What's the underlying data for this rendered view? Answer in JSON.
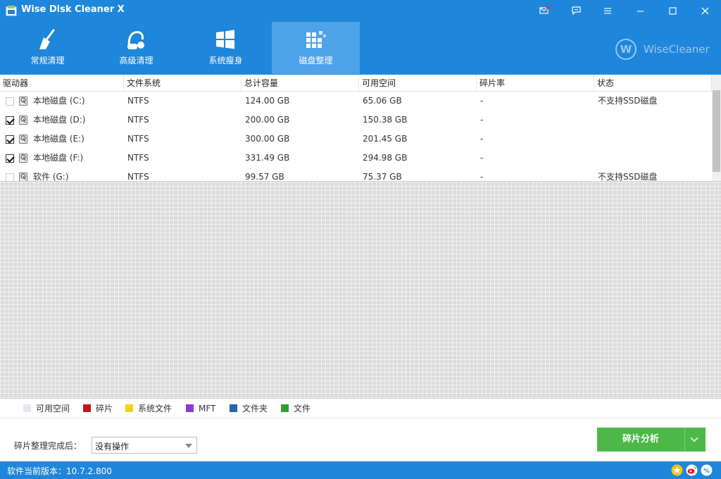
{
  "window": {
    "title": "Wise Disk Cleaner X"
  },
  "tabs": [
    {
      "label": "常规清理",
      "icon": "broom-icon",
      "active": false
    },
    {
      "label": "高级清理",
      "icon": "vacuum-icon",
      "active": false
    },
    {
      "label": "系统瘦身",
      "icon": "windows-icon",
      "active": false
    },
    {
      "label": "磁盘整理",
      "icon": "defrag-blocks-icon",
      "active": true
    }
  ],
  "brand": {
    "logo_letter": "W",
    "name": "WiseCleaner"
  },
  "table": {
    "columns": [
      "驱动器",
      "文件系统",
      "总计容量",
      "可用空间",
      "碎片率",
      "状态"
    ],
    "rows": [
      {
        "checked": false,
        "drive": "本地磁盘 (C:)",
        "fs": "NTFS",
        "total": "124.00 GB",
        "free": "65.06 GB",
        "frag": "-",
        "status": "不支持SSD磁盘"
      },
      {
        "checked": true,
        "drive": "本地磁盘 (D:)",
        "fs": "NTFS",
        "total": "200.00 GB",
        "free": "150.38 GB",
        "frag": "-",
        "status": ""
      },
      {
        "checked": true,
        "drive": "本地磁盘 (E:)",
        "fs": "NTFS",
        "total": "300.00 GB",
        "free": "201.45 GB",
        "frag": "-",
        "status": ""
      },
      {
        "checked": true,
        "drive": "本地磁盘 (F:)",
        "fs": "NTFS",
        "total": "331.49 GB",
        "free": "294.98 GB",
        "frag": "-",
        "status": ""
      },
      {
        "checked": false,
        "drive": "软件 (G:)",
        "fs": "NTFS",
        "total": "99.57 GB",
        "free": "75.37 GB",
        "frag": "-",
        "status": "不支持SSD磁盘"
      }
    ]
  },
  "legend": [
    {
      "label": "可用空间",
      "color": "#e4e6ee"
    },
    {
      "label": "碎片",
      "color": "#c21818"
    },
    {
      "label": "系统文件",
      "color": "#f5d21a"
    },
    {
      "label": "MFT",
      "color": "#8a3ad6"
    },
    {
      "label": "文件夹",
      "color": "#2a63a8"
    },
    {
      "label": "文件",
      "color": "#2ea12e"
    }
  ],
  "bottom": {
    "after_label": "碎片整理完成后：",
    "after_value": "没有操作",
    "analyze_label": "碎片分析"
  },
  "status": {
    "version_text": "软件当前版本：10.7.2.800"
  },
  "colors": {
    "brand_blue": "#1e86db",
    "active_tab": "#4ea3e8",
    "button_green": "#4cb847"
  }
}
